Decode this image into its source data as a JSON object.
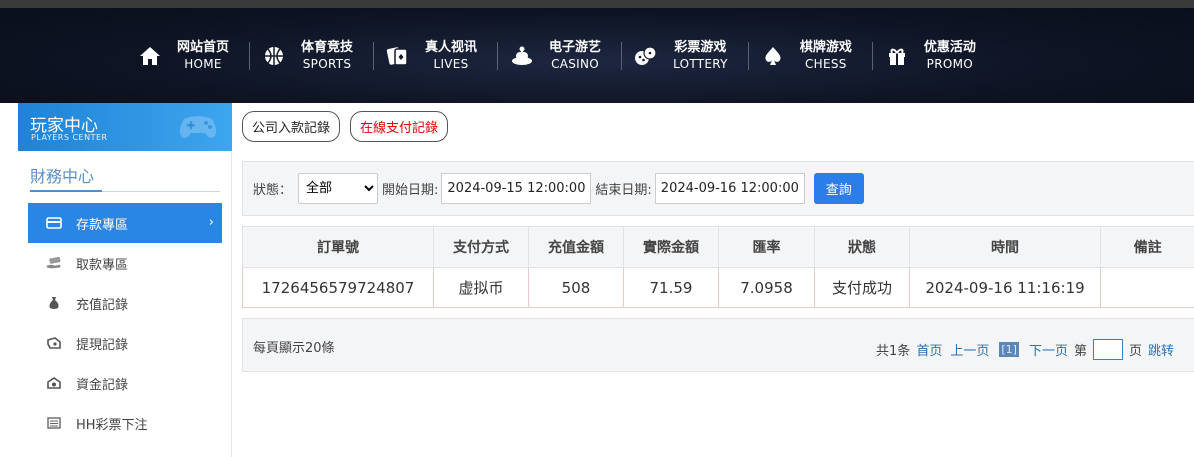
{
  "nav": [
    {
      "cn": "网站首页",
      "en": "HOME",
      "icon": "home-icon"
    },
    {
      "cn": "体育竞技",
      "en": "SPORTS",
      "icon": "basketball-icon"
    },
    {
      "cn": "真人视讯",
      "en": "LIVES",
      "icon": "cards-icon"
    },
    {
      "cn": "电子游艺",
      "en": "CASINO",
      "icon": "slot-machine-icon"
    },
    {
      "cn": "彩票游戏",
      "en": "LOTTERY",
      "icon": "dice-icon"
    },
    {
      "cn": "棋牌游戏",
      "en": "CHESS",
      "icon": "spade-icon"
    },
    {
      "cn": "优惠活动",
      "en": "PROMO",
      "icon": "gift-icon"
    }
  ],
  "sidebar": {
    "title": "玩家中心",
    "subtitle": "PLAYERS CENTER",
    "section": "財務中心",
    "items": [
      {
        "label": "存款專區",
        "icon": "card-icon",
        "active": true
      },
      {
        "label": "取款專區",
        "icon": "cash-hand-icon"
      },
      {
        "label": "充值記錄",
        "icon": "money-bag-icon"
      },
      {
        "label": "提現記錄",
        "icon": "withdraw-icon"
      },
      {
        "label": "資金記錄",
        "icon": "fund-icon"
      },
      {
        "label": "HH彩票下注",
        "icon": "list-icon"
      }
    ]
  },
  "tabs": [
    "公司入款記錄",
    "在線支付記錄"
  ],
  "filter": {
    "status_label": "狀態：",
    "status_value": "全部",
    "start_label": "開始日期:",
    "start_value": "2024-09-15 12:00:00",
    "end_label": "結束日期:",
    "end_value": "2024-09-16 12:00:00",
    "query_label": "查詢"
  },
  "table": {
    "headers": [
      "訂單號",
      "支付方式",
      "充值金額",
      "實際金額",
      "匯率",
      "狀態",
      "時間",
      "備註"
    ],
    "rows": [
      [
        "1726456579724807",
        "虚拟币",
        "508",
        "71.59",
        "7.0958",
        "支付成功",
        "2024-09-16 11:16:19",
        ""
      ]
    ]
  },
  "pager": {
    "per_page": "每頁顯示20條",
    "total": "共1条",
    "first": "首页",
    "prev": "上一页",
    "current": "[1]",
    "next": "下一页",
    "page_prefix": "第",
    "page_suffix": "页",
    "jump": "跳转"
  },
  "colors": {
    "accent": "#2a86e4",
    "query": "#2b7de9",
    "online_tab": "#e10000"
  }
}
